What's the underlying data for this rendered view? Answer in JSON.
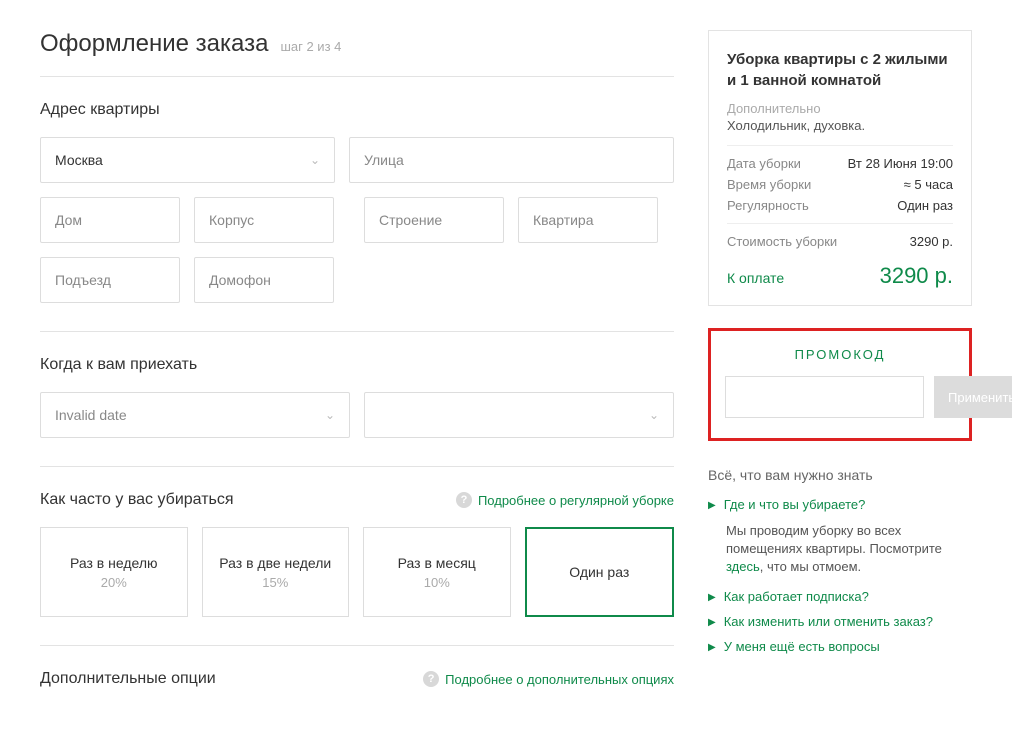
{
  "header": {
    "title": "Оформление заказа",
    "step": "шаг 2 из 4"
  },
  "address": {
    "title": "Адрес квартиры",
    "city": "Москва",
    "street_ph": "Улица",
    "house_ph": "Дом",
    "korpus_ph": "Корпус",
    "stroenie_ph": "Строение",
    "kvartira_ph": "Квартира",
    "podezd_ph": "Подъезд",
    "domofon_ph": "Домофон"
  },
  "when": {
    "title": "Когда к вам приехать",
    "date": "Invalid date",
    "time": ""
  },
  "freq": {
    "title": "Как часто у вас убираться",
    "help": "Подробнее о регулярной уборке",
    "options": [
      {
        "label": "Раз в неделю",
        "discount": "20%"
      },
      {
        "label": "Раз в две недели",
        "discount": "15%"
      },
      {
        "label": "Раз в месяц",
        "discount": "10%"
      },
      {
        "label": "Один раз",
        "discount": ""
      }
    ]
  },
  "extras": {
    "title": "Дополнительные опции",
    "help": "Подробнее о дополнительных опциях"
  },
  "summary": {
    "title": "Уборка квартиры с 2 жилыми и 1 ванной комнатой",
    "sub": "Дополнительно",
    "extra": "Холодильник, духовка.",
    "rows": [
      {
        "label": "Дата уборки",
        "value": "Вт 28 Июня 19:00"
      },
      {
        "label": "Время уборки",
        "value": "≈ 5 часа"
      },
      {
        "label": "Регулярность",
        "value": "Один раз"
      }
    ],
    "cost_label": "Стоимость уборки",
    "cost_value": "3290 р.",
    "pay_label": "К оплате",
    "pay_value": "3290 р."
  },
  "promo": {
    "title": "ПРОМОКОД",
    "apply": "Применить"
  },
  "faq": {
    "title": "Всё, что вам нужно знать",
    "q1": "Где и что вы убираете?",
    "a1_pre": "Мы проводим уборку во всех помещениях квартиры. Посмотрите ",
    "a1_link": "здесь",
    "a1_post": ", что мы отмоем.",
    "q2": "Как работает подписка?",
    "q3": "Как изменить или отменить заказ?",
    "q4": "У меня ещё есть вопросы"
  }
}
